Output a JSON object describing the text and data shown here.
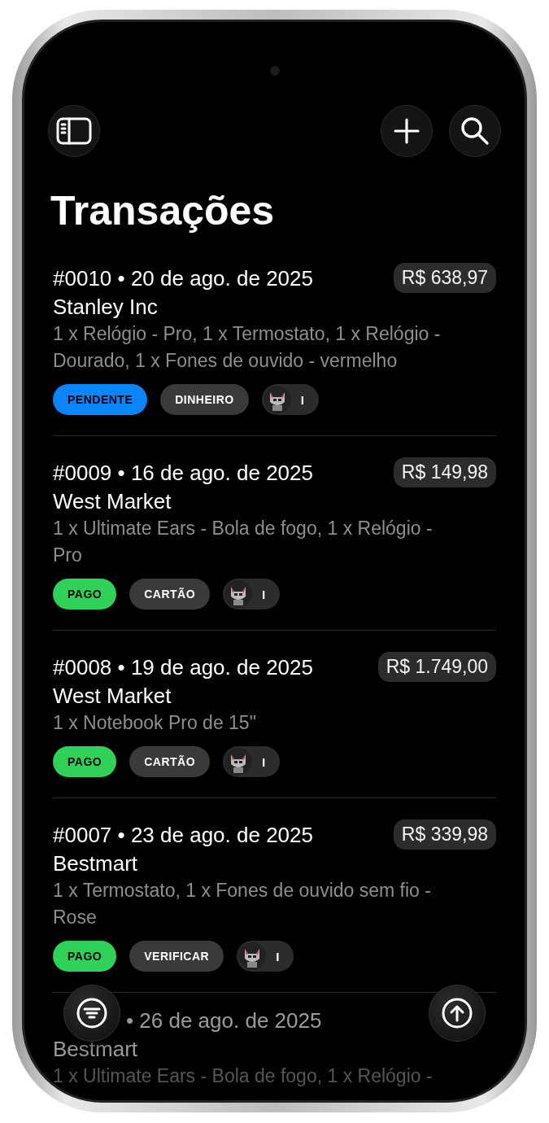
{
  "title": "Transações",
  "transactions": [
    {
      "number": "#0010",
      "date": "20 de ago. de 2025",
      "amount": "R$ 638,97",
      "customer": "Stanley Inc",
      "items": "1 x Relógio - Pro, 1 x Termostato, 1 x Relógio - Dourado, 1 x Fones de ouvido - vermelho",
      "status": {
        "label": "PENDENTE",
        "color": "#0a84ff"
      },
      "payment": "DINHEIRO",
      "seller": "I"
    },
    {
      "number": "#0009",
      "date": "16 de ago. de 2025",
      "amount": "R$ 149,98",
      "customer": "West Market",
      "items": "1 x Ultimate Ears - Bola de fogo, 1 x Relógio - Pro",
      "status": {
        "label": "PAGO",
        "color": "#30d158"
      },
      "payment": "CARTÃO",
      "seller": "I"
    },
    {
      "number": "#0008",
      "date": "19 de ago. de 2025",
      "amount": "R$ 1.749,00",
      "customer": "West Market",
      "items": "1 x Notebook Pro de 15\"",
      "status": {
        "label": "PAGO",
        "color": "#30d158"
      },
      "payment": "CARTÃO",
      "seller": "I"
    },
    {
      "number": "#0007",
      "date": "23 de ago. de 2025",
      "amount": "R$ 339,98",
      "customer": "Bestmart",
      "items": "1 x Termostato, 1 x Fones de ouvido sem fio - Rose",
      "status": {
        "label": "PAGO",
        "color": "#30d158"
      },
      "payment": "VERIFICAR",
      "seller": "I"
    }
  ],
  "separator": "•",
  "partial_transaction": {
    "date": "• 26 de ago. de 2025",
    "customer": "Bestmart",
    "items": "1 x Ultimate Ears - Bola de fogo, 1 x Relógio -"
  }
}
